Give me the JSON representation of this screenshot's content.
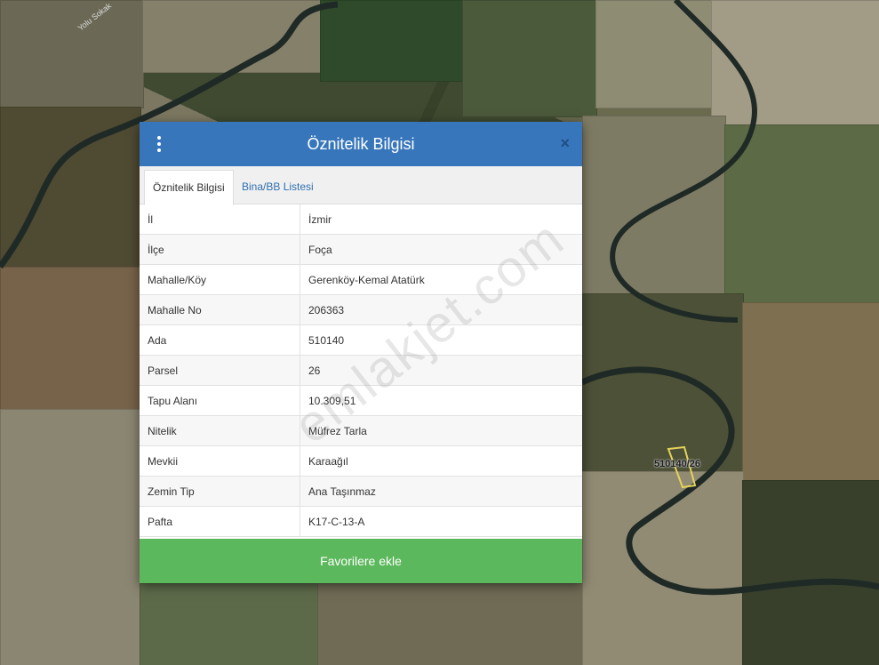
{
  "map": {
    "road_label": "Yolu Sokak",
    "parcel_label": "510140/26"
  },
  "modal": {
    "title": "Öznitelik Bilgisi",
    "close_glyph": "×",
    "tabs": [
      {
        "label": "Öznitelik Bilgisi",
        "active": true
      },
      {
        "label": "Bina/BB Listesi",
        "active": false
      }
    ],
    "rows": [
      {
        "key": "İl",
        "value": "İzmir"
      },
      {
        "key": "İlçe",
        "value": "Foça"
      },
      {
        "key": "Mahalle/Köy",
        "value": "Gerenköy-Kemal Atatürk"
      },
      {
        "key": "Mahalle No",
        "value": "206363"
      },
      {
        "key": "Ada",
        "value": "510140"
      },
      {
        "key": "Parsel",
        "value": "26"
      },
      {
        "key": "Tapu Alanı",
        "value": "10.309,51"
      },
      {
        "key": "Nitelik",
        "value": "Müfrez Tarla"
      },
      {
        "key": "Mevkii",
        "value": "Karaağıl"
      },
      {
        "key": "Zemin Tip",
        "value": "Ana Taşınmaz"
      },
      {
        "key": "Pafta",
        "value": "K17-C-13-A"
      }
    ],
    "favorite_button": "Favorilere ekle"
  },
  "watermark": "emlakjet.com",
  "colors": {
    "header": "#3776bb",
    "button": "#5cb85c",
    "parcel_outline": "#e5d35a"
  }
}
